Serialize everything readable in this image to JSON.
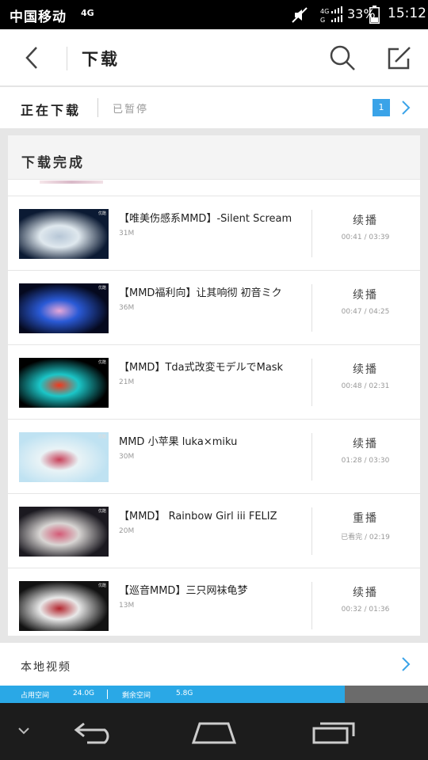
{
  "status_bar": {
    "carrier": "中国移动",
    "network": "4G",
    "signal_label": "4G",
    "battery": "33%",
    "time": "15:12"
  },
  "title_bar": {
    "title": "下载",
    "back_icon": "chevron-left-icon",
    "search_icon": "search-icon",
    "edit_icon": "edit-icon"
  },
  "tabs": {
    "active": "正在下载",
    "paused": "已暂停",
    "count": "1"
  },
  "completed": {
    "header": "下载完成",
    "items": [
      {
        "title": "【唯美伤感系MMD】-Silent Scream",
        "size": "31M",
        "action": "续播",
        "progress": "00:41 / 03:39",
        "thumb": [
          "#0b1a33",
          "#dfe8ee",
          "#b6c6d6"
        ]
      },
      {
        "title": "【MMD福利向】让其响彻 初音ミク",
        "size": "36M",
        "action": "续播",
        "progress": "00:47 / 04:25",
        "thumb": [
          "#05091e",
          "#2a5ad6",
          "#e6a7d9"
        ]
      },
      {
        "title": "【MMD】Tda式改変モデルでMask",
        "size": "21M",
        "action": "续播",
        "progress": "00:48 / 02:31",
        "thumb": [
          "#000000",
          "#1bc6c8",
          "#f1381c"
        ]
      },
      {
        "title": "MMD 小苹果 luka×miku",
        "size": "30M",
        "action": "续播",
        "progress": "01:28 / 03:30",
        "thumb": [
          "#bfe2f2",
          "#e9f3f6",
          "#c9415a"
        ]
      },
      {
        "title": "【MMD】 Rainbow Girl iii FELIZ",
        "size": "20M",
        "action": "重播",
        "progress": "已看完 / 02:19",
        "thumb": [
          "#1b1920",
          "#d8d5d3",
          "#d45b77"
        ]
      },
      {
        "title": "【巡音MMD】三只网袜龟梦",
        "size": "13M",
        "action": "续播",
        "progress": "00:32 / 01:36",
        "thumb": [
          "#121212",
          "#e9e9e9",
          "#b3262e"
        ]
      }
    ]
  },
  "local_video": {
    "label": "本地视频"
  },
  "storage": {
    "used_label": "占用空间",
    "used_value": "24.0G",
    "free_label": "剩余空间",
    "free_value": "5.8G",
    "used_fraction": 0.805
  },
  "colors": {
    "accent": "#2aa8e6",
    "badge": "#3aa3e8"
  }
}
